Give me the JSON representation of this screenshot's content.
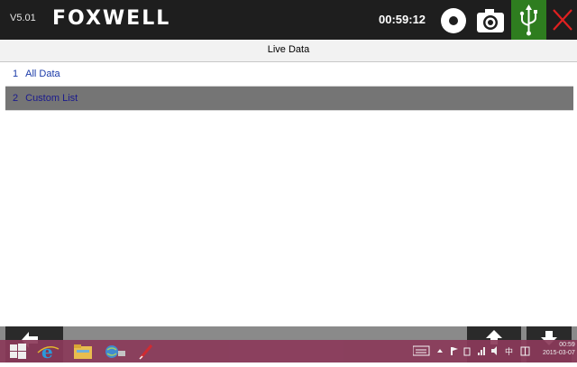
{
  "app": {
    "version": "V5.01",
    "brand": "FOXWELL",
    "clock": "00:59:12"
  },
  "header": {
    "title": "Live Data"
  },
  "list": [
    {
      "index": "1",
      "label": "All Data",
      "selected": false
    },
    {
      "index": "2",
      "label": "Custom List",
      "selected": true
    }
  ],
  "taskbar": {
    "time": "00:59",
    "date": "2015-03-07"
  },
  "colors": {
    "topbar": "#1e1e1e",
    "usb_green": "#2e7d1f",
    "close_red": "#e02020",
    "selected_row": "#757575",
    "link_blue": "#1a3aa8",
    "taskbar": "#8b3a5a"
  },
  "icons": {
    "record": "record-icon",
    "camera": "camera-icon",
    "usb": "usb-icon",
    "close": "close-icon",
    "back": "back-arrow-icon",
    "page_up": "page-up-icon",
    "page_down": "page-down-icon"
  }
}
